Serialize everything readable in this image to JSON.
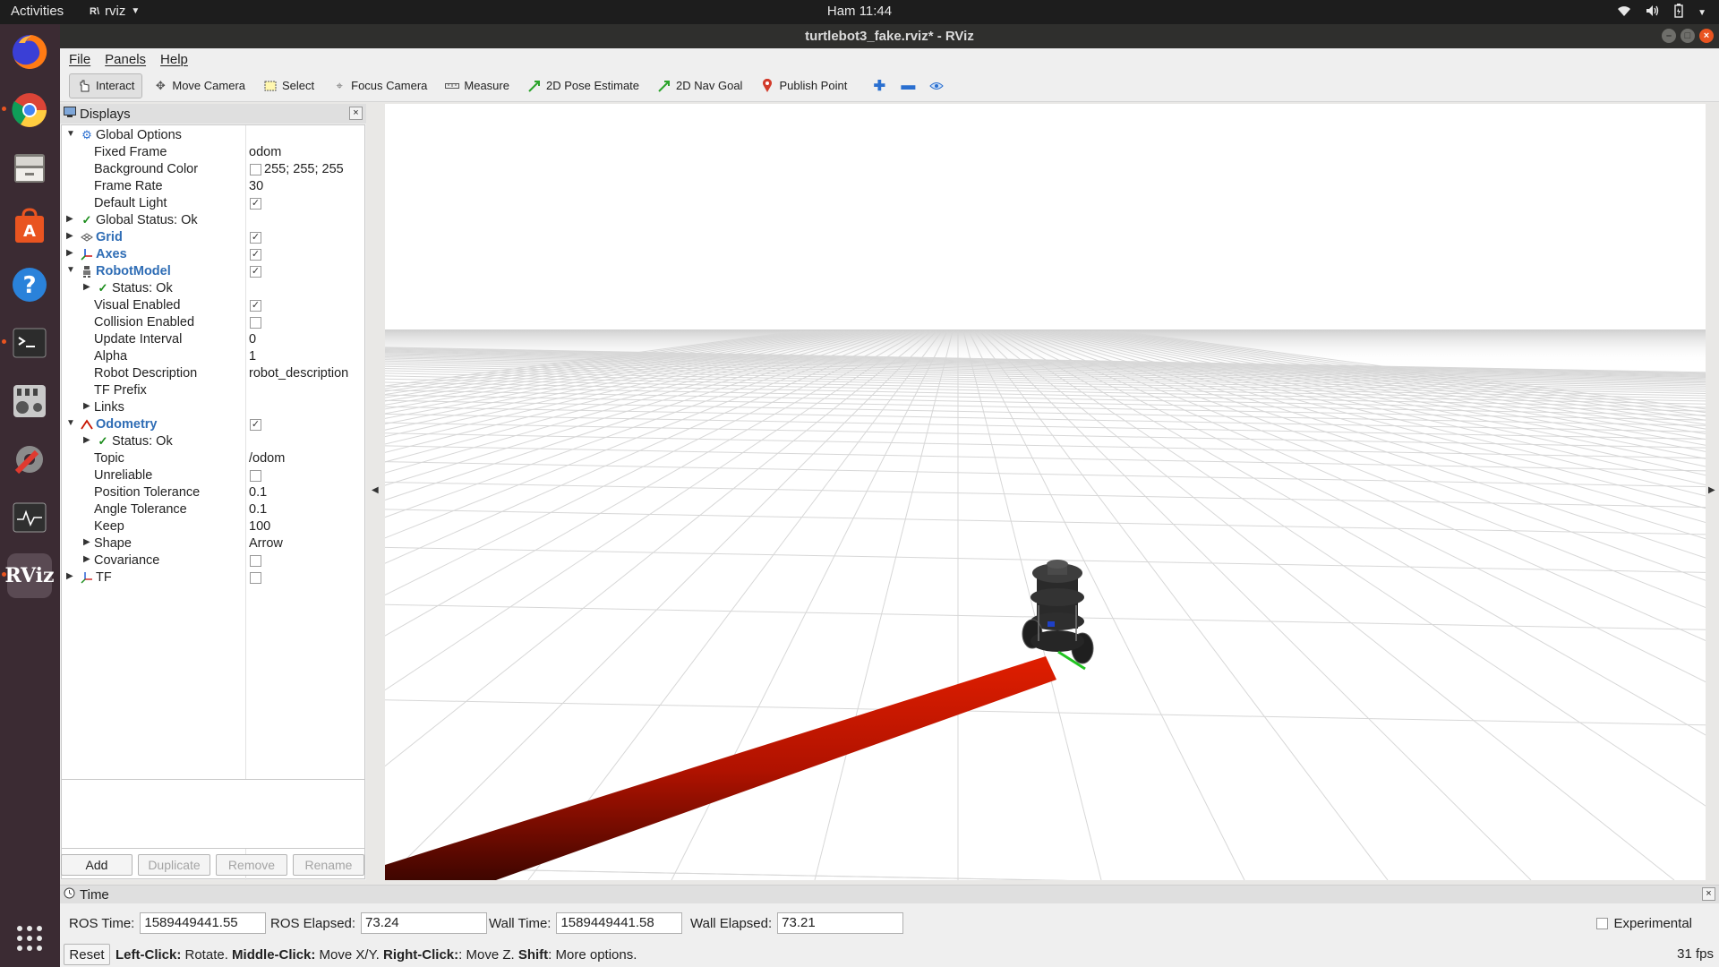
{
  "topbar": {
    "activities": "Activities",
    "app_name": "rviz",
    "clock": "Ham 11:44"
  },
  "dock": {
    "items": [
      "Firefox",
      "Google Chrome",
      "Files",
      "Ubuntu Software",
      "Help",
      "Terminal",
      "Mixer",
      "Settings",
      "System Monitor",
      "RViz"
    ]
  },
  "window": {
    "title": "turtlebot3_fake.rviz* - RViz"
  },
  "menu": {
    "file": "File",
    "panels": "Panels",
    "help": "Help"
  },
  "toolbar": {
    "interact": "Interact",
    "move_camera": "Move Camera",
    "select": "Select",
    "focus_camera": "Focus Camera",
    "measure": "Measure",
    "pose_estimate": "2D Pose Estimate",
    "nav_goal": "2D Nav Goal",
    "publish_point": "Publish Point"
  },
  "displays": {
    "title": "Displays",
    "global_options": "Global Options",
    "fixed_frame_label": "Fixed Frame",
    "fixed_frame_value": "odom",
    "bg_color_label": "Background Color",
    "bg_color_value": "255; 255; 255",
    "frame_rate_label": "Frame Rate",
    "frame_rate_value": "30",
    "default_light_label": "Default Light",
    "global_status": "Global Status: Ok",
    "grid": "Grid",
    "axes": "Axes",
    "robot_model": "RobotModel",
    "status_ok": "Status: Ok",
    "visual_enabled": "Visual Enabled",
    "collision_enabled": "Collision Enabled",
    "update_interval_label": "Update Interval",
    "update_interval_value": "0",
    "alpha_label": "Alpha",
    "alpha_value": "1",
    "robot_description_label": "Robot Description",
    "robot_description_value": "robot_description",
    "tf_prefix": "TF Prefix",
    "links": "Links",
    "odometry": "Odometry",
    "odom_status": "Status: Ok",
    "topic_label": "Topic",
    "topic_value": "/odom",
    "unreliable": "Unreliable",
    "pos_tol_label": "Position Tolerance",
    "pos_tol_value": "0.1",
    "ang_tol_label": "Angle Tolerance",
    "ang_tol_value": "0.1",
    "keep_label": "Keep",
    "keep_value": "100",
    "shape_label": "Shape",
    "shape_value": "Arrow",
    "covariance": "Covariance",
    "tf": "TF",
    "buttons": {
      "add": "Add",
      "duplicate": "Duplicate",
      "remove": "Remove",
      "rename": "Rename"
    }
  },
  "time": {
    "title": "Time",
    "ros_time_label": "ROS Time:",
    "ros_time_value": "1589449441.55",
    "ros_elapsed_label": "ROS Elapsed:",
    "ros_elapsed_value": "73.24",
    "wall_time_label": "Wall Time:",
    "wall_time_value": "1589449441.58",
    "wall_elapsed_label": "Wall Elapsed:",
    "wall_elapsed_value": "73.21",
    "experimental": "Experimental"
  },
  "status": {
    "reset": "Reset",
    "left_click": "Left-Click:",
    "left_click_action": " Rotate. ",
    "middle_click": "Middle-Click:",
    "middle_click_action": " Move X/Y. ",
    "right_click": "Right-Click:",
    "right_click_action": ": Move Z. ",
    "shift": "Shift",
    "shift_action": ": More options.",
    "fps": "31 fps"
  },
  "colors": {
    "accent": "#e95420",
    "display_blue": "#2f6db5",
    "odometry_red": "#c81400",
    "status_green": "#1a8c1a"
  }
}
